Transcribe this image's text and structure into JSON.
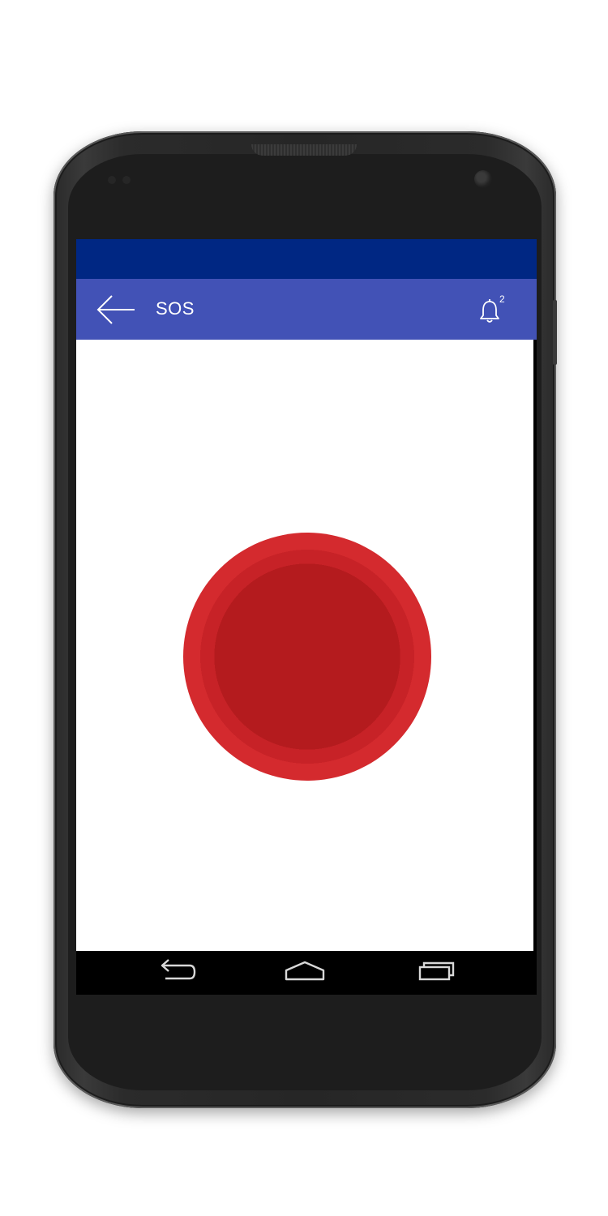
{
  "app_bar": {
    "title": "SOS",
    "back_icon": "arrow-left-icon",
    "notifications": {
      "icon": "bell-icon",
      "count": "2"
    }
  },
  "sos_button": {
    "icon": "sos-alert-button",
    "colors": [
      "#b41b1e",
      "#c72227",
      "#d42a2e",
      "#e33535",
      "#f0413b",
      "#f6453f",
      "#fd5256"
    ]
  },
  "navigation_bar": {
    "back_icon": "back-nav-icon",
    "home_icon": "home-nav-icon",
    "recents_icon": "recents-nav-icon"
  },
  "theme": {
    "status_bar_color": "#002783",
    "app_bar_color": "#4252b6",
    "content_background": "#ffffff"
  }
}
